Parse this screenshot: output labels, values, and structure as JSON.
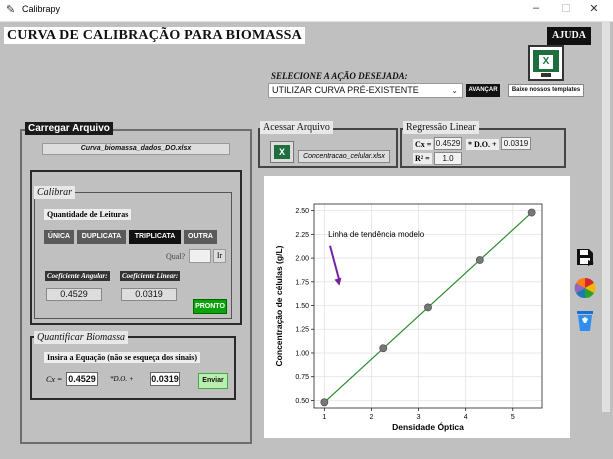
{
  "window": {
    "title": "Calibrapy",
    "minimize": "–",
    "maximize": "☐",
    "close": "✕"
  },
  "banner": "CURVA DE CALIBRAÇÃO PARA BIOMASSA",
  "help_label": "AJUDA",
  "excel_glyph": "X",
  "action": {
    "label": "SELECIONE A AÇÃO DESEJADA:",
    "selected": "UTILIZAR CURVA PRÉ-EXISTENTE",
    "go_label": "AVANÇAR",
    "templates_label": "Baixe nossos templates"
  },
  "load": {
    "title": "Carregar Arquivo",
    "file_name": "Curva_biomassa_dados_DO.xlsx"
  },
  "calibrate": {
    "title": "Calibrar",
    "readings_label": "Quantidade de Leituras",
    "options": [
      "ÚNICA",
      "DUPLICATA",
      "TRIPLICATA",
      "OUTRA"
    ],
    "selected_option": "TRIPLICATA",
    "qual_label": "Qual?",
    "qual_value": "",
    "ir_label": "Ir",
    "angular_label": "Coeficiente Angular:",
    "linear_label": "Coeficiente Linear:",
    "angular_value": "0.4529",
    "linear_value": "0.0319",
    "done_label": "PRONTO"
  },
  "quantify": {
    "title": "Quantificar Biomassa",
    "instruction": "Insira a Equação (não se esqueça dos sinais)",
    "cx_label": "Cx =",
    "slope": "0.4529",
    "do_label": "*D.O. +",
    "intercept": "0.0319",
    "send_label": "Enviar"
  },
  "access": {
    "title": "Acessar Arquivo",
    "file_name": "Concentracao_celular.xlsx"
  },
  "regression": {
    "title": "Regressão Linear",
    "cx_label": "Cx =",
    "slope": "0.4529",
    "do_label": "* D.O. +",
    "intercept": "0.0319",
    "r2_label": "R² =",
    "r2_value": "1.0"
  },
  "chart_data": {
    "type": "scatter",
    "title": "",
    "xlabel": "Densidade Óptica",
    "ylabel": "Concentração de células (g/L)",
    "xlim": [
      0.78,
      5.62
    ],
    "ylim": [
      0.42,
      2.57
    ],
    "xticks": [
      1,
      2,
      3,
      4,
      5
    ],
    "yticks": [
      0.5,
      0.75,
      1.0,
      1.25,
      1.5,
      1.75,
      2.0,
      2.25,
      2.5
    ],
    "ytick_labels": [
      "0.50",
      "0.75",
      "1.00",
      "1.25",
      "1.50",
      "1.75",
      "2.00",
      "2.25",
      "2.50"
    ],
    "grid": true,
    "annotation": "Linha de tendência modelo",
    "points": {
      "x": [
        1.0,
        2.25,
        3.2,
        4.3,
        5.4
      ],
      "y": [
        0.48,
        1.05,
        1.48,
        1.98,
        2.48
      ]
    },
    "trendline": {
      "slope": 0.4529,
      "intercept": 0.0319,
      "x_range": [
        1.0,
        5.4
      ]
    },
    "colors": {
      "points": "#777777",
      "line": "#2e8b2e",
      "arrow": "#7a1fa2"
    }
  },
  "side_icons": [
    "save-icon",
    "palette-icon",
    "recycle-bin-icon"
  ]
}
